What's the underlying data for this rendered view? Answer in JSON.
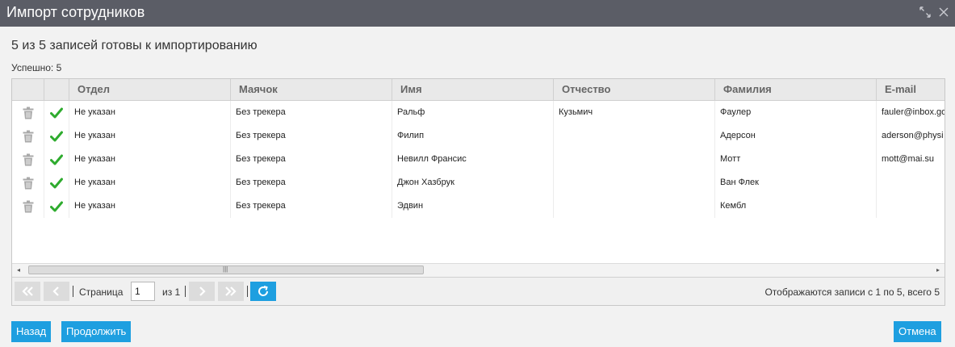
{
  "window": {
    "title": "Импорт сотрудников"
  },
  "summary": {
    "heading": "5 из 5 записей готовы к импортированию",
    "success": "Успешно: 5"
  },
  "grid": {
    "columns": [
      "Отдел",
      "Маячок",
      "Имя",
      "Отчество",
      "Фамилия",
      "E-mail"
    ],
    "rows": [
      [
        "Не указан",
        "Без трекера",
        "Ральф",
        "Кузьмич",
        "Фаулер",
        "fauler@inbox.go"
      ],
      [
        "Не указан",
        "Без трекера",
        "Филип",
        "",
        "Адерсон",
        "aderson@physi"
      ],
      [
        "Не указан",
        "Без трекера",
        "Невилл Франсис",
        "",
        "Мотт",
        "mott@mai.su"
      ],
      [
        "Не указан",
        "Без трекера",
        "Джон Хазбрук",
        "",
        "Ван Флек",
        ""
      ],
      [
        "Не указан",
        "Без трекера",
        "Эдвин",
        "",
        "Кембл",
        ""
      ]
    ]
  },
  "scrollbar": {
    "left_arrow": "◂",
    "right_arrow": "▸",
    "grip": "|||"
  },
  "pager": {
    "page_label": "Страница",
    "page_value": "1",
    "of_label": "из 1",
    "info": "Отображаются записи с 1 по 5, всего 5"
  },
  "buttons": {
    "back": "Назад",
    "continue": "Продолжить",
    "cancel": "Отмена"
  },
  "icons": {
    "row_delete": "trash-icon",
    "row_status": "checkmark-icon",
    "first_page": "double-chevron-left-icon",
    "prev_page": "chevron-left-icon",
    "next_page": "chevron-right-icon",
    "last_page": "double-chevron-right-icon",
    "refresh": "refresh-icon",
    "maximize": "maximize-icon",
    "close": "close-icon"
  },
  "colors": {
    "accent": "#1e9fe0",
    "title_bar": "#5b5d66",
    "check": "#2eab2e"
  }
}
